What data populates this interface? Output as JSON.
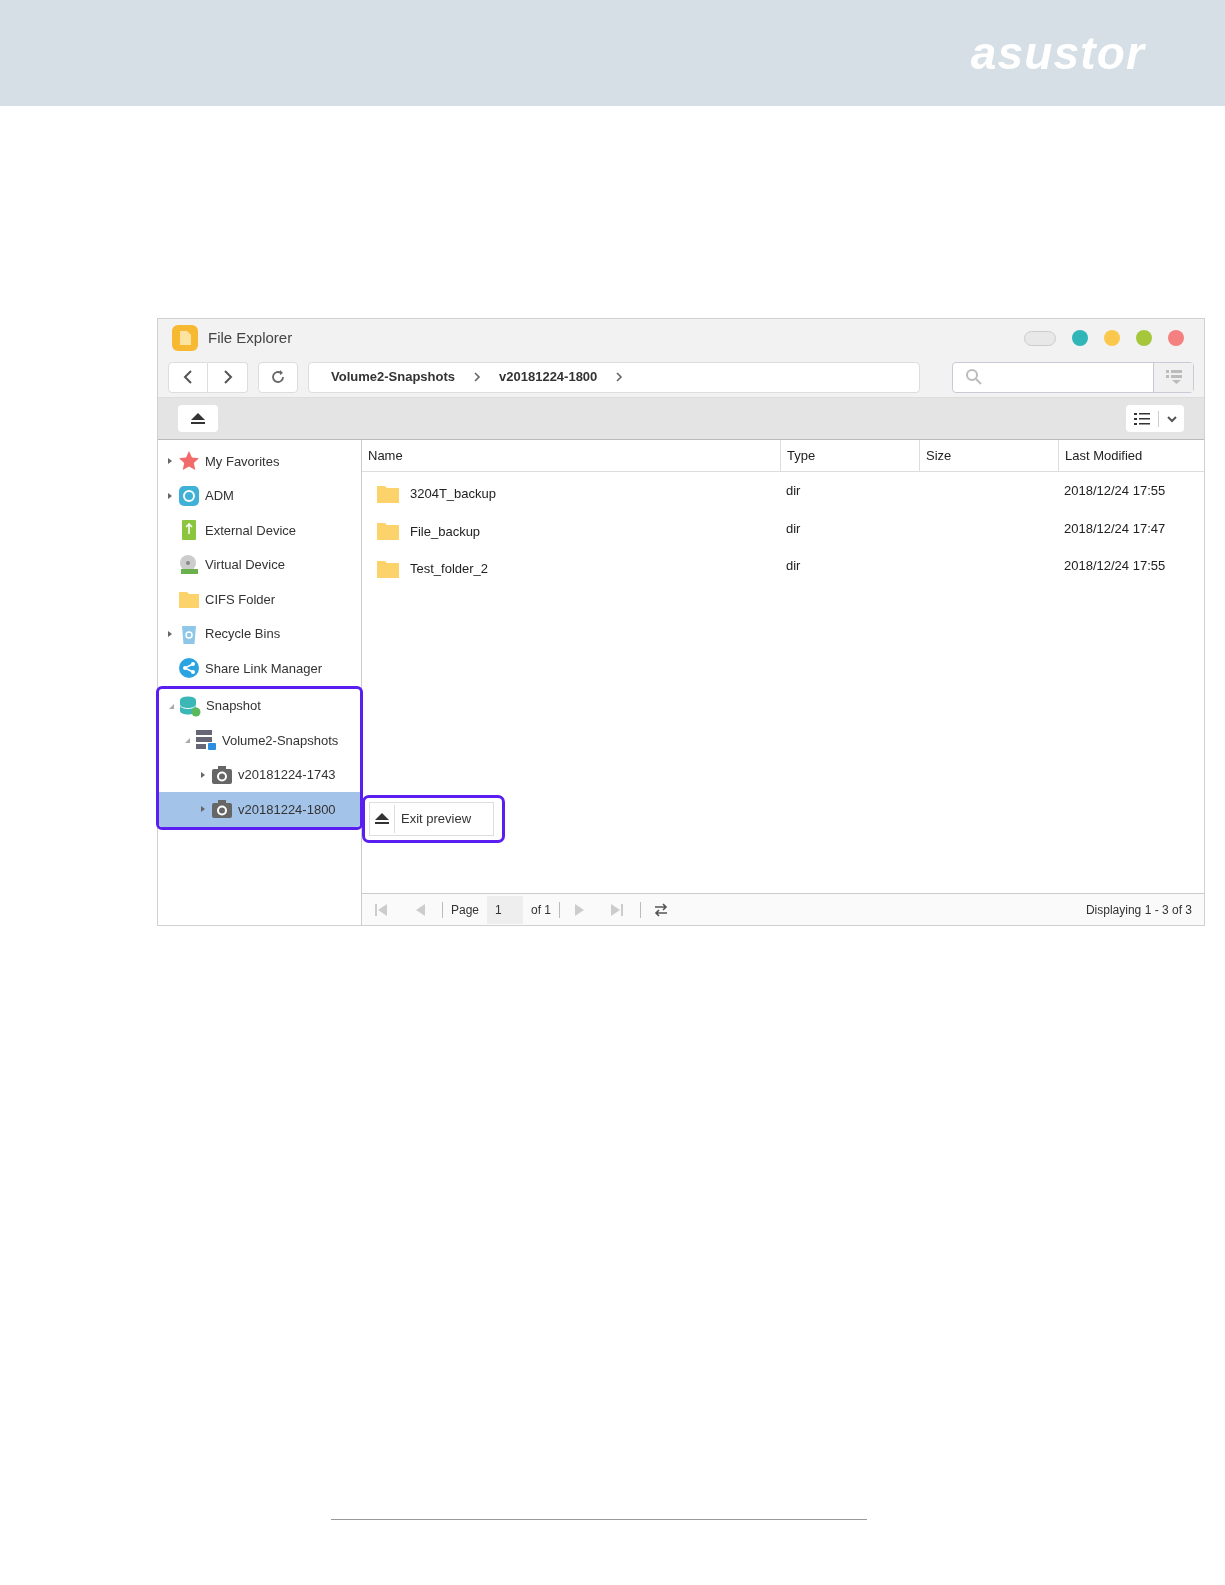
{
  "brand": "asustor",
  "window": {
    "title": "File Explorer"
  },
  "breadcrumb": [
    "Volume2-Snapshots",
    "v20181224-1800"
  ],
  "tree": [
    {
      "label": "My Favorites",
      "kind": "star",
      "expandable": true,
      "expanded": false,
      "selected": false
    },
    {
      "label": "ADM",
      "kind": "adm",
      "expandable": true,
      "expanded": false,
      "selected": false
    },
    {
      "label": "External Device",
      "kind": "usb",
      "expandable": false,
      "selected": false
    },
    {
      "label": "Virtual Device",
      "kind": "disc",
      "expandable": false,
      "selected": false
    },
    {
      "label": "CIFS Folder",
      "kind": "folder",
      "expandable": false,
      "selected": false
    },
    {
      "label": "Recycle Bins",
      "kind": "bin",
      "expandable": true,
      "expanded": false,
      "selected": false
    },
    {
      "label": "Share Link Manager",
      "kind": "share",
      "expandable": false,
      "selected": false
    },
    {
      "label": "Snapshot",
      "kind": "database",
      "expandable": true,
      "expanded": true,
      "selected": false,
      "highlighted": true,
      "children": [
        {
          "label": "Volume2-Snapshots",
          "kind": "server",
          "expandable": true,
          "expanded": true,
          "selected": false,
          "children": [
            {
              "label": "v20181224-1743",
              "kind": "camera",
              "expandable": true,
              "expanded": false,
              "selected": false
            },
            {
              "label": "v20181224-1800",
              "kind": "camera",
              "expandable": true,
              "expanded": false,
              "selected": true
            }
          ]
        }
      ]
    }
  ],
  "table": {
    "columns": [
      "Name",
      "Type",
      "Size",
      "Last Modified"
    ],
    "rows": [
      {
        "name": "3204T_backup",
        "type": "dir",
        "modified": "2018/12/24 17:55"
      },
      {
        "name": "File_backup",
        "type": "dir",
        "modified": "2018/12/24 17:47"
      },
      {
        "name": "Test_folder_2",
        "type": "dir",
        "modified": "2018/12/24 17:55"
      }
    ]
  },
  "exit_preview": {
    "label": "Exit preview",
    "highlighted": true
  },
  "pager": {
    "page_label": "Page",
    "page": "1",
    "of": "of 1",
    "status": "Displaying 1 - 3 of 3"
  }
}
